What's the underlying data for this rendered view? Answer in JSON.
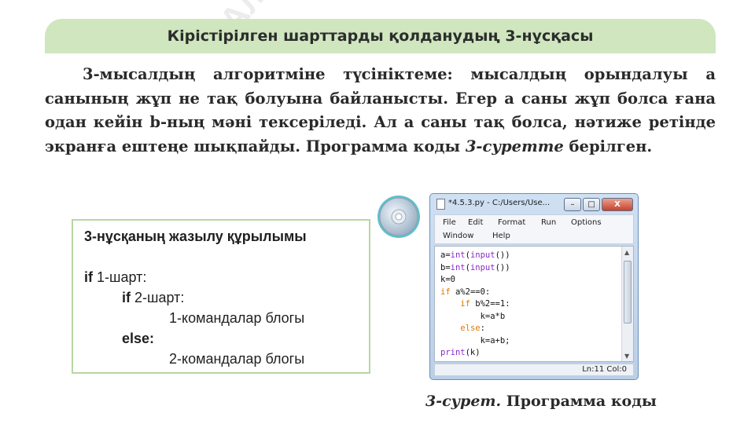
{
  "watermark": "Алматы",
  "banner": {
    "title": "Кірістірілген шарттарды қолданудың 3-нұсқасы"
  },
  "paragraph": {
    "text_before": "3-мысалдың алгоритміне түсініктеме: мысалдың орындалуы а санының жұп не тақ болуына байланысты. Егер а саны жұп болса ғана одан кейін b-ның мәні тексеріледі. Ал а саны тақ болса, нәтиже ретінде экранға ештеңе шықпайды. Программа коды ",
    "emphasis": "3-суретте",
    "text_after": " берілген."
  },
  "syntax_box": {
    "title": "3-нұсқаның жазылу құрылымы",
    "line1_kw": "if",
    "line1_text": " 1-шарт:",
    "line2_kw": "if",
    "line2_text": " 2-шарт:",
    "line3_text": "1-командалар блогы",
    "line4_kw": "else:",
    "line5_text": "2-командалар блогы"
  },
  "ide": {
    "window_title": "*4.5.3.py - C:/Users/Use...",
    "buttons": {
      "minimize": "–",
      "maximize": "□",
      "close": "X"
    },
    "menu": {
      "file": "File",
      "edit": "Edit",
      "format": "Format",
      "run": "Run",
      "options": "Options",
      "window": "Window",
      "help": "Help"
    },
    "code_lines": [
      "a=int(input())",
      "b=int(input())",
      "k=0",
      "if a%2==0:",
      "    if b%2==1:",
      "        k=a*b",
      "    else:",
      "        k=a+b;",
      "print(k)"
    ],
    "status": "Ln:11  Col:0"
  },
  "caption": {
    "emphasis": "3-сурет.",
    "text": " Программа коды"
  },
  "colors": {
    "banner_bg": "#cfe6bf",
    "box_border": "#b7d7a3",
    "keyword": "#d97a00",
    "builtin": "#8a28c9"
  },
  "icons": [
    "cd-disc-icon",
    "python-file-icon"
  ]
}
